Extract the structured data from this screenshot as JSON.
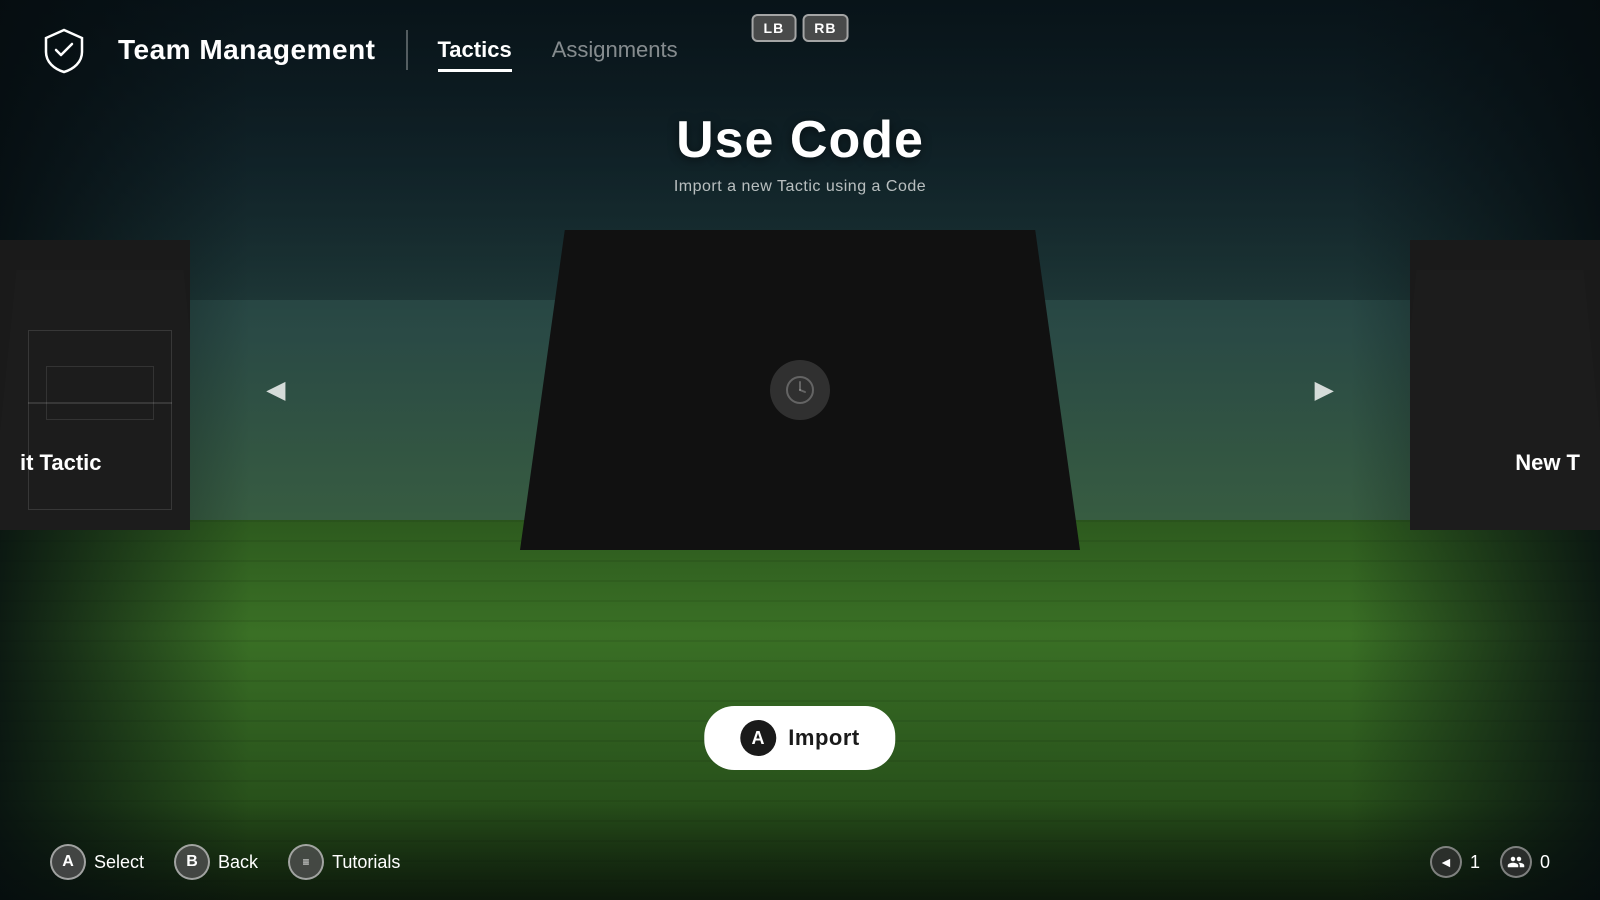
{
  "header": {
    "title": "Team Management",
    "logo_icon": "shield-icon",
    "tabs": [
      {
        "id": "tactics",
        "label": "Tactics",
        "active": true
      },
      {
        "id": "assignments",
        "label": "Assignments",
        "active": false
      }
    ]
  },
  "controller_buttons": {
    "lb": "LB",
    "rb": "RB"
  },
  "page": {
    "title": "Use Code",
    "subtitle": "Import a new Tactic using a Code"
  },
  "cards": {
    "left_label": "it Tactic",
    "right_label": "New T",
    "center_icon": "⏱"
  },
  "arrows": {
    "left": "◄",
    "right": "►"
  },
  "import_button": {
    "btn_label": "A",
    "label": "Import"
  },
  "bottom_controls": [
    {
      "id": "select",
      "btn": "A",
      "label": "Select"
    },
    {
      "id": "back",
      "btn": "B",
      "label": "Back"
    },
    {
      "id": "tutorials",
      "btn": "≡",
      "label": "Tutorials"
    }
  ],
  "bottom_right": {
    "nav_icon": "◄",
    "count1": "1",
    "people_icon": "👥",
    "count2": "0"
  }
}
